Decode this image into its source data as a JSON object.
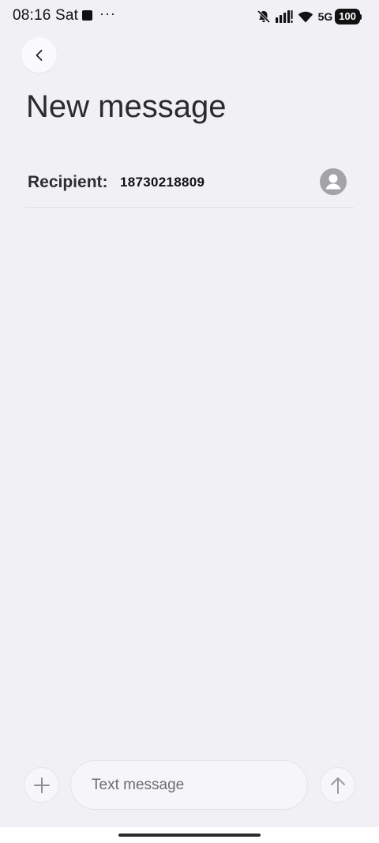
{
  "status_bar": {
    "time": "08:16 Sat",
    "more_indicator": "···",
    "network_label": "5G",
    "battery_level": "100"
  },
  "header": {
    "title": "New message"
  },
  "recipient": {
    "label": "Recipient:",
    "value": "18730218809"
  },
  "composer": {
    "placeholder": "Text message"
  },
  "icons": {
    "back": "chevron-left-icon",
    "contact": "person-icon",
    "attach": "plus-icon",
    "send": "arrow-up-icon",
    "mute": "bell-off-icon",
    "signal": "signal-icon",
    "wifi": "wifi-icon"
  },
  "colors": {
    "background": "#f1f0f5",
    "title_text": "#2b2b2e",
    "icon_gray": "#8e8e93"
  }
}
